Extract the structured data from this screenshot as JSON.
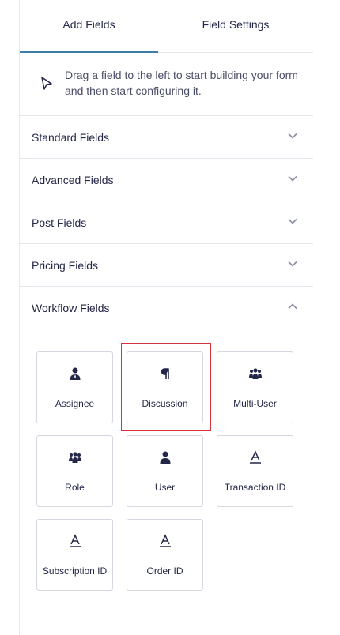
{
  "tabs": [
    {
      "label": "Add Fields",
      "active": true
    },
    {
      "label": "Field Settings",
      "active": false
    }
  ],
  "hint": {
    "text": "Drag a field to the left to start building your form and then start configuring it.",
    "icon": "cursor-arrow-icon"
  },
  "sections": [
    {
      "label": "Standard Fields",
      "expanded": false
    },
    {
      "label": "Advanced Fields",
      "expanded": false
    },
    {
      "label": "Post Fields",
      "expanded": false
    },
    {
      "label": "Pricing Fields",
      "expanded": false
    }
  ],
  "workflow": {
    "label": "Workflow Fields",
    "expanded": true,
    "fields": [
      {
        "label": "Assignee",
        "icon": "person-icon"
      },
      {
        "label": "Discussion",
        "icon": "pilcrow-icon",
        "highlighted": true
      },
      {
        "label": "Multi-User",
        "icon": "group-icon"
      },
      {
        "label": "Role",
        "icon": "group-icon"
      },
      {
        "label": "User",
        "icon": "person-icon"
      },
      {
        "label": "Transaction ID",
        "icon": "text-a-icon"
      },
      {
        "label": "Subscription ID",
        "icon": "text-a-icon"
      },
      {
        "label": "Order ID",
        "icon": "text-a-icon"
      }
    ]
  },
  "colors": {
    "accent": "#3e7da6",
    "highlight": "#d9313b",
    "border": "#e6e7ee"
  }
}
